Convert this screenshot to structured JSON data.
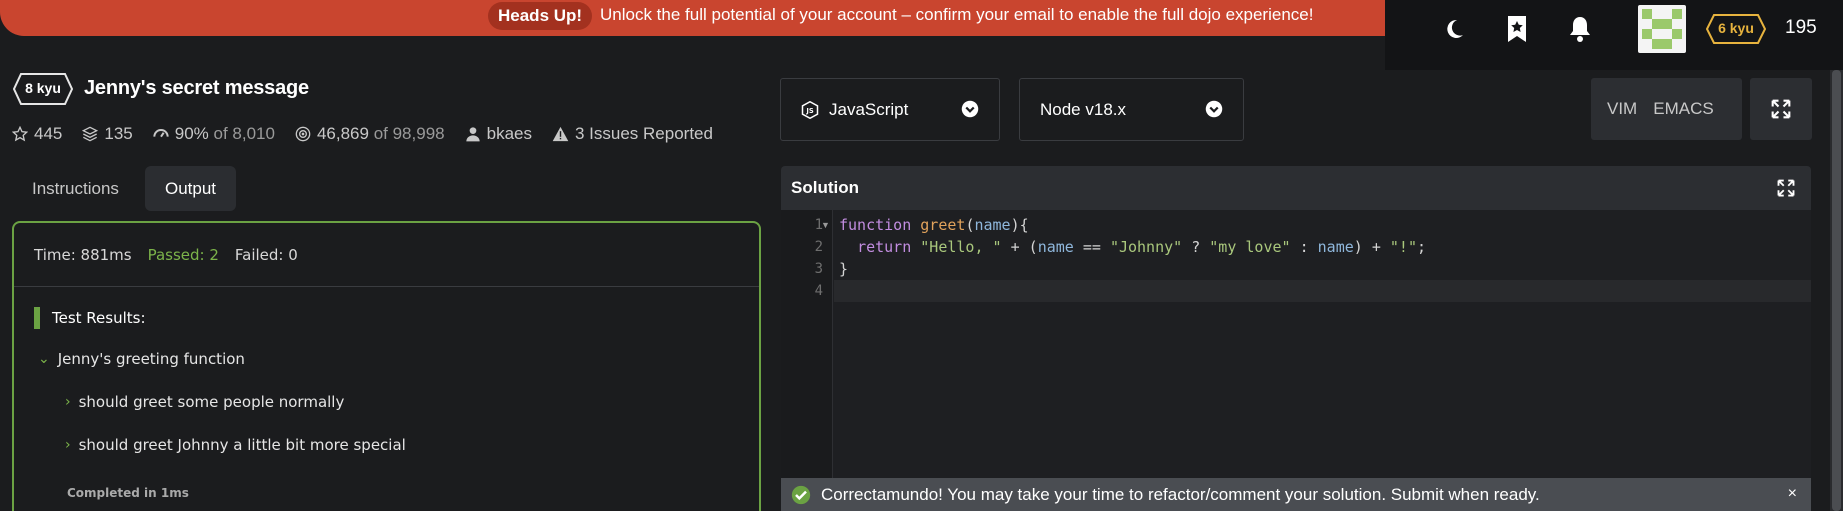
{
  "banner": {
    "tag": "Heads Up!",
    "message": "Unlock the full potential of your account – confirm your email to enable the full dojo experience!"
  },
  "topbar": {
    "icons": [
      "moon-icon",
      "bookmark-star-icon",
      "bell-icon"
    ],
    "rank": "6 kyu",
    "honor": "195"
  },
  "kata": {
    "rank": "8 kyu",
    "title": "Jenny's secret message",
    "stats": {
      "stars": "445",
      "collections": "135",
      "satisfaction": "90%",
      "satisfaction_of": "of 8,010",
      "completed": "46,869",
      "completed_of": "of 98,998",
      "author": "bkaes",
      "issues": "3 Issues Reported"
    }
  },
  "tabs": {
    "instructions": "Instructions",
    "output": "Output"
  },
  "output": {
    "time": "Time: 881ms",
    "passed": "Passed: 2",
    "failed": "Failed: 0",
    "results_title": "Test Results:",
    "group": "Jenny's greeting function",
    "tests": [
      "should greet some people normally",
      "should greet Johnny a little bit more special"
    ],
    "completed": "Completed in 1ms"
  },
  "editor_controls": {
    "language": "JavaScript",
    "version": "Node v18.x",
    "vim": "VIM",
    "emacs": "EMACS"
  },
  "solution": {
    "label": "Solution",
    "line_numbers": [
      "1",
      "2",
      "3",
      "4"
    ]
  },
  "success": {
    "message": "Correctamundo! You may take your time to refactor/comment your solution. Submit when ready.",
    "close": "×"
  },
  "colors": {
    "banner": "#c9452f",
    "accent_green": "#6ba243",
    "rank_yellow": "#e7b33e"
  }
}
